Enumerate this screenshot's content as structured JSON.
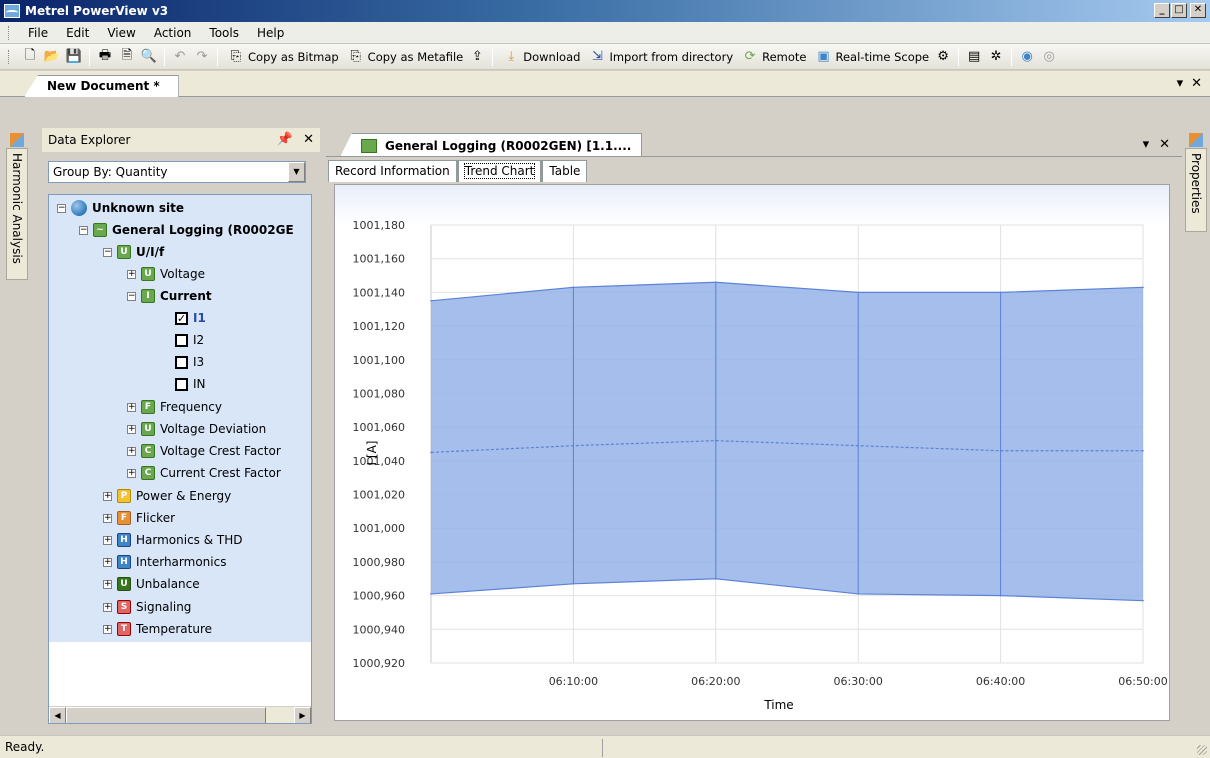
{
  "app": {
    "title": "Metrel PowerView v3"
  },
  "menu": [
    "File",
    "Edit",
    "View",
    "Action",
    "Tools",
    "Help"
  ],
  "toolbar": {
    "copy_bitmap": "Copy as Bitmap",
    "copy_metafile": "Copy as Metafile",
    "download": "Download",
    "import": "Import from directory",
    "remote": "Remote",
    "scope": "Real-time Scope"
  },
  "document": {
    "tab": "New Document *"
  },
  "side": {
    "left": "Harmonic Analysis",
    "right": "Properties"
  },
  "explorer": {
    "title": "Data Explorer",
    "group_by": "Group By: Quantity",
    "tree": {
      "site": "Unknown site",
      "logging": "General Logging (R0002GE",
      "uif": "U/I/f",
      "voltage": "Voltage",
      "current": "Current",
      "i1": "I1",
      "i2": "I2",
      "i3": "I3",
      "in": "IN",
      "frequency": "Frequency",
      "voltage_deviation": "Voltage Deviation",
      "voltage_crest": "Voltage Crest Factor",
      "current_crest": "Current Crest Factor",
      "power": "Power & Energy",
      "flicker": "Flicker",
      "harmonics": "Harmonics & THD",
      "interharmonics": "Interharmonics",
      "unbalance": "Unbalance",
      "signaling": "Signaling",
      "temperature": "Temperature"
    }
  },
  "panel": {
    "tab": "General Logging (R0002GEN) [1.1....",
    "subtabs": [
      "Record Information",
      "Trend Chart",
      "Table"
    ]
  },
  "chart_data": {
    "type": "area",
    "xlabel": "Time",
    "ylabel": "I [A]",
    "ylim": [
      1000.92,
      1001.18
    ],
    "yticks": [
      "1001,180",
      "1001,160",
      "1001,140",
      "1001,120",
      "1001,100",
      "1001,080",
      "1001,060",
      "1001,040",
      "1001,020",
      "1001,000",
      "1000,980",
      "1000,960",
      "1000,940",
      "1000,920"
    ],
    "xticks": [
      "06:10:00",
      "06:20:00",
      "06:30:00",
      "06:40:00",
      "06:50:00"
    ],
    "x": [
      "06:00:00",
      "06:10:00",
      "06:20:00",
      "06:30:00",
      "06:40:00",
      "06:50:00"
    ],
    "series": [
      {
        "values": [
          1001.135,
          1001.143,
          1001.146,
          1001.14,
          1001.14,
          1001.143
        ]
      },
      {
        "values": [
          1001.045,
          1001.049,
          1001.052,
          1001.049,
          1001.046,
          1001.046
        ]
      },
      {
        "values": [
          1000.961,
          1000.967,
          1000.97,
          1000.961,
          1000.96,
          1000.957
        ]
      }
    ],
    "colors": {
      "fill": "#95b3e8",
      "line": "#5b82d6"
    },
    "grid": true
  },
  "status": {
    "text": "Ready."
  }
}
